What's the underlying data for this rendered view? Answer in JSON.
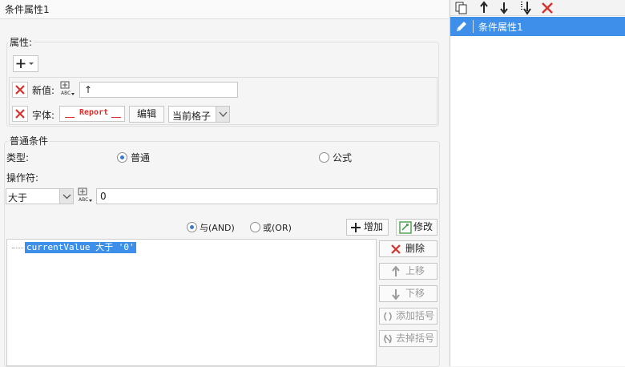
{
  "window": {
    "title": "条件属性1"
  },
  "attributes": {
    "legend": "属性:",
    "rows": [
      {
        "label": "新值:",
        "value": "↑"
      },
      {
        "label": "字体:",
        "font_preview": "Report",
        "edit_label": "编辑",
        "scope_value": "当前格子"
      }
    ]
  },
  "condition": {
    "legend": "普通条件",
    "type_label": "类型:",
    "type_options": [
      "普通",
      "公式"
    ],
    "type_selected": "普通",
    "operator_label": "操作符:",
    "operator_value": "大于",
    "operand_value": "0",
    "logic_options": [
      "与(AND)",
      "或(OR)"
    ],
    "logic_selected": "与(AND)",
    "add_label": "增加",
    "modify_label": "修改",
    "expressions": [
      "currentValue 大于 '0'"
    ],
    "side_buttons": [
      {
        "label": "删除",
        "enabled": true
      },
      {
        "label": "上移",
        "enabled": false
      },
      {
        "label": "下移",
        "enabled": false
      },
      {
        "label": "添加括号",
        "enabled": false
      },
      {
        "label": "去掉括号",
        "enabled": false
      }
    ]
  },
  "right_panel": {
    "items": [
      {
        "label": "条件属性1",
        "selected": true
      }
    ],
    "toolbar_icons": [
      "copy-icon",
      "arrow-up-icon",
      "arrow-down-icon",
      "move-bottom-icon",
      "delete-icon"
    ]
  },
  "colors": {
    "selection": "#3d8fea",
    "delete_red": "#d9302c",
    "add_green": "#3b9a3b"
  }
}
